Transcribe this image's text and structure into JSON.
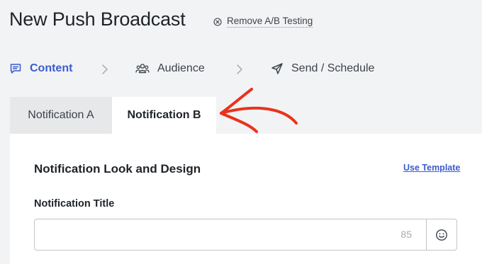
{
  "header": {
    "title": "New Push Broadcast",
    "remove_ab_label": "Remove A/B Testing"
  },
  "steps": [
    {
      "label": "Content",
      "icon": "message-icon",
      "active": true
    },
    {
      "label": "Audience",
      "icon": "users-icon",
      "active": false
    },
    {
      "label": "Send / Schedule",
      "icon": "send-icon",
      "active": false
    }
  ],
  "tabs": [
    {
      "label": "Notification A",
      "active": false
    },
    {
      "label": "Notification B",
      "active": true
    }
  ],
  "panel": {
    "section_title": "Notification Look and Design",
    "use_template_label": "Use Template",
    "title_field_label": "Notification Title",
    "title_value": "",
    "title_char_count": "85"
  },
  "colors": {
    "accent": "#3b5ccc",
    "annotation_arrow": "#e8341c",
    "page_background": "#f2f3f5"
  }
}
